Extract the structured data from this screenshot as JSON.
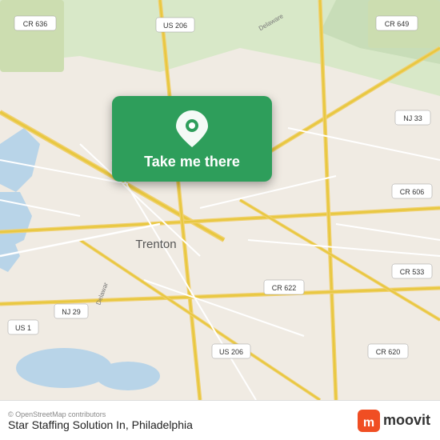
{
  "map": {
    "attribution": "© OpenStreetMap contributors",
    "place_name": "Star Staffing Solution In, Philadelphia",
    "city_label": "Trenton",
    "bg_color": "#e8e0d8"
  },
  "cta": {
    "button_label": "Take me there",
    "icon": "location-pin-icon"
  },
  "footer": {
    "logo_text": "moovit",
    "attribution": "© OpenStreetMap contributors",
    "place_name": "Star Staffing Solution In, Philadelphia"
  },
  "road_labels": {
    "cr636": "CR 636",
    "us206_top": "US 206",
    "cr649": "CR 649",
    "nj33": "NJ 33",
    "cr606": "CR 606",
    "cr622": "CR 622",
    "nj29": "NJ 29",
    "us1": "US 1",
    "us206_bottom": "US 206",
    "cr533": "CR 533",
    "cr620": "CR 620"
  }
}
